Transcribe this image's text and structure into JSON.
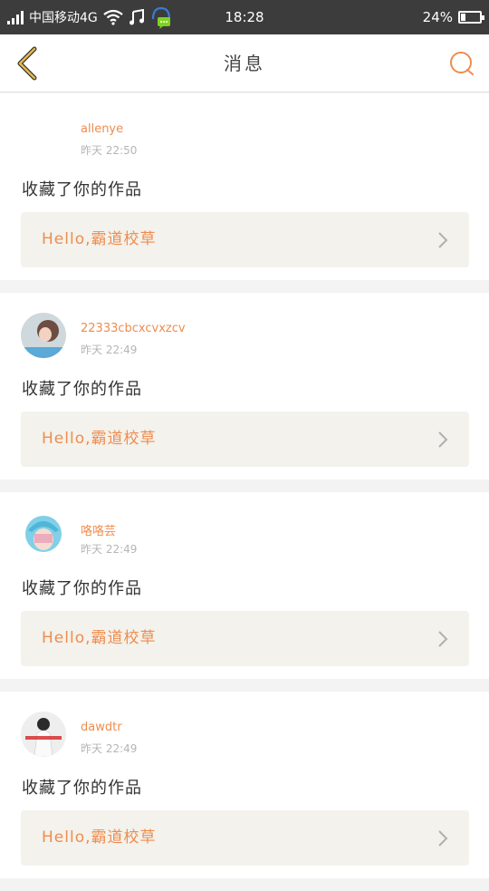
{
  "status_bar": {
    "carrier": "中国移动4G",
    "time": "18:28",
    "battery": "24%",
    "battery_level": 0.24
  },
  "header": {
    "title": "消息",
    "back_icon": "chevron-left-icon",
    "search_icon": "search-icon"
  },
  "colors": {
    "accent": "#ef8c4e",
    "back_icon": "#e8b84a",
    "card_link_bg": "#f3f2ec",
    "page_bg": "#f3f3f3"
  },
  "messages": [
    {
      "username": "allenye",
      "time": "昨天 22:50",
      "action": "收藏了你的作品",
      "work_title": "Hello,霸道校草",
      "avatar": "blank-avatar"
    },
    {
      "username": "22333cbcxcvxzcv",
      "time": "昨天 22:49",
      "action": "收藏了你的作品",
      "work_title": "Hello,霸道校草",
      "avatar": "photo-avatar"
    },
    {
      "username": "咯咯芸",
      "time": "昨天 22:49",
      "action": "收藏了你的作品",
      "work_title": "Hello,霸道校草",
      "avatar": "anime-avatar"
    },
    {
      "username": "dawdtr",
      "time": "昨天 22:49",
      "action": "收藏了你的作品",
      "work_title": "Hello,霸道校草",
      "avatar": "photo-avatar"
    }
  ]
}
